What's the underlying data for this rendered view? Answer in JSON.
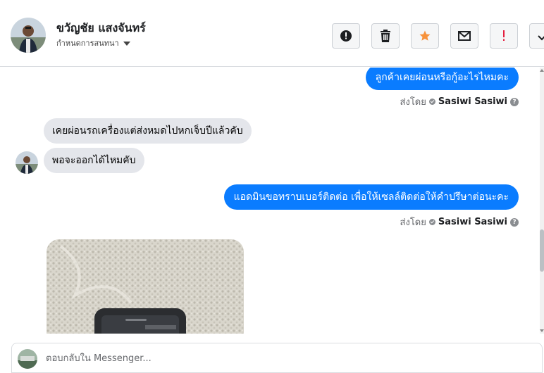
{
  "header": {
    "contact_name": "ขวัญชัย แสงจันทร์",
    "subtitle": "กำหนดการสนทนา",
    "actions": [
      {
        "name": "report-button",
        "icon": "alert-circle-icon"
      },
      {
        "name": "delete-button",
        "icon": "trash-icon"
      },
      {
        "name": "star-button",
        "icon": "star-icon",
        "color": "#f7923b"
      },
      {
        "name": "mark-unread-button",
        "icon": "envelope-icon"
      },
      {
        "name": "spam-button",
        "icon": "exclamation-icon",
        "color": "#e41e3f"
      },
      {
        "name": "done-button",
        "icon": "check-icon"
      }
    ]
  },
  "messages": [
    {
      "direction": "out",
      "text": "ลูกค้าเคยผ่อนหรือกู้อะไรไหมคะ"
    },
    {
      "direction": "meta",
      "sent_by_label": "ส่งโดย",
      "sender": "Sasiwi Sasiwi"
    },
    {
      "direction": "in",
      "text": "เคยผ่อนรถเครื่องแต่ส่งหมดไปหกเจ็บปีแล้วคับ"
    },
    {
      "direction": "in",
      "text": "พอจะออกได้ไหมคับ"
    },
    {
      "direction": "out",
      "text": "แอดมินขอทราบเบอร์ติดต่อ เพื่อให้เซลล์ติดต่อให้คำปรึษาต่อนะคะ"
    },
    {
      "direction": "meta",
      "sent_by_label": "ส่งโดย",
      "sender": "Sasiwi Sasiwi"
    }
  ],
  "composer": {
    "placeholder": "ตอบกลับใน Messenger..."
  },
  "colors": {
    "outgoing_bubble": "#0a7cff",
    "incoming_bubble": "#e4e6eb",
    "star": "#f7923b",
    "spam": "#e41e3f"
  }
}
